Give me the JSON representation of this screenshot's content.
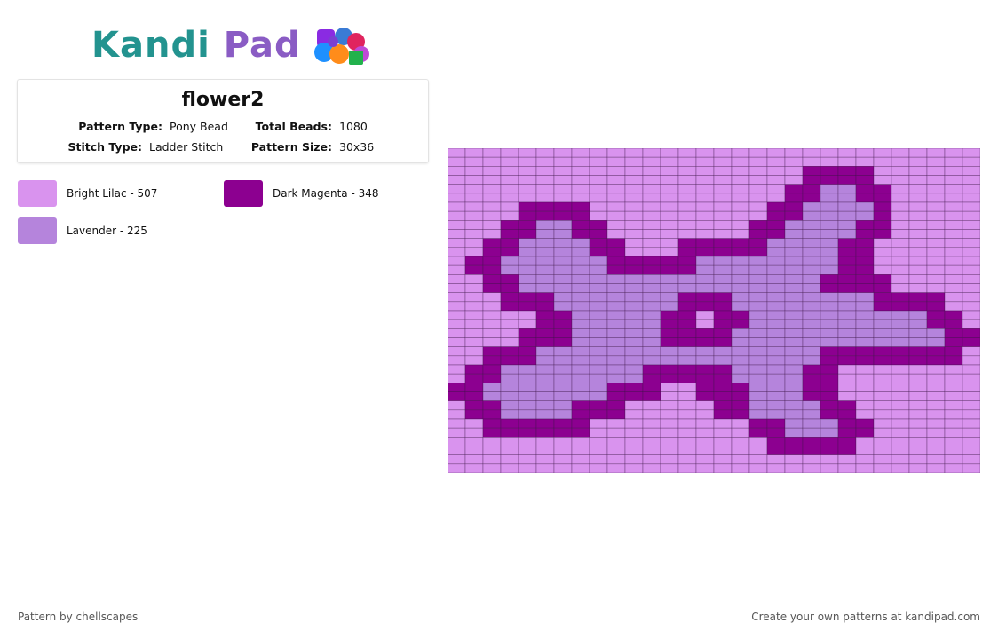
{
  "logo": {
    "part1": "Kandi",
    "part2": "Pad"
  },
  "pattern": {
    "title": "flower2",
    "pattern_type_label": "Pattern Type:",
    "pattern_type": "Pony Bead",
    "total_beads_label": "Total Beads:",
    "total_beads": "1080",
    "stitch_type_label": "Stitch Type:",
    "stitch_type": "Ladder Stitch",
    "pattern_size_label": "Pattern Size:",
    "pattern_size": "30x36"
  },
  "palette": [
    {
      "label": "Bright Lilac - 507",
      "color": "#d993ee"
    },
    {
      "label": "Dark Magenta - 348",
      "color": "#8c0090"
    },
    {
      "label": "Lavender - 225",
      "color": "#b584dc"
    }
  ],
  "grid": {
    "cols": 30,
    "rows": 18,
    "bead_rows_printed_note": "",
    "colors": {
      "A": "#d993ee",
      "B": "#8c0090",
      "C": "#b584dc"
    },
    "cells": [
      "AAAAAAAAAAAAAAAAAAAAAAAAAAAAAA",
      "AAAAAAAAAAAAAAAAAAAABBBBAAAAAA",
      "AAAAAAAAAAAAAAAAAAABBCCBBAAAAA",
      "AAAABBBBAAAAAAAAAABBCCCCBAAAAA",
      "AAABBCCBBAAAAAAAABBCCCCBBAAAAA",
      "AABBCCCCBBAAABBBBBCCCCBBAAAAAA",
      "ABBCCCCCCBBBBBCCCCCCCCBBAAAAAA",
      "AABBCCCCCCCCCCCCCCCCCBBBBAAAAA",
      "AAABBBCCCCCCCBBBCCCCCCCCBBBBAA",
      "AAAAABBCCCCCBBABBCCCCCCCCCCBBA",
      "AAAABBBCCCCCBBBBCCCCCCCCCCCCBB",
      "AABBBCCCCCCCCCCCCCCCCBBBBBBBBA",
      "ABBCCCCCCCCBBBBBCCCCBBAAAAAAAA",
      "BBCCCCCCCBBBAABBBCCCBBAAAAAAAA",
      "ABBCCCCBBBAAAAABBCCCCBBAAAAAAA",
      "AABBBBBBAAAAAAAAABBCCCBBAAAAAA",
      "AAAAAAAAAAAAAAAAAABBBBBAAAAAAA",
      "AAAAAAAAAAAAAAAAAAAAAAAAAAAAAA"
    ]
  },
  "footer": {
    "left": "Pattern by chellscapes",
    "right": "Create your own patterns at kandipad.com"
  }
}
